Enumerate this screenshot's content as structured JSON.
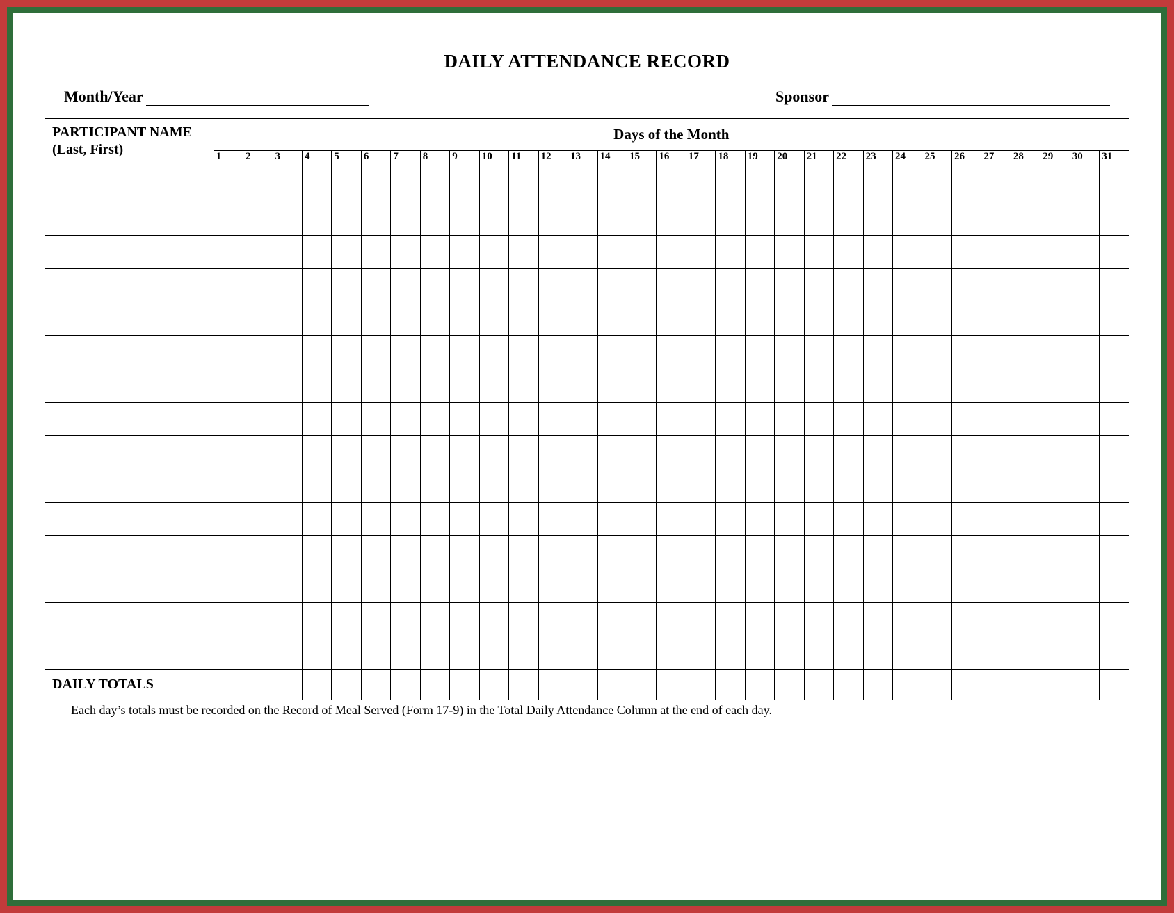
{
  "title": "DAILY ATTENDANCE RECORD",
  "meta": {
    "month_year_label": "Month/Year",
    "month_year_value": "",
    "sponsor_label": "Sponsor",
    "sponsor_value": ""
  },
  "table": {
    "participant_header": "PARTICIPANT NAME (Last, First)",
    "days_header": "Days of the Month",
    "days": [
      "1",
      "2",
      "3",
      "4",
      "5",
      "6",
      "7",
      "8",
      "9",
      "10",
      "11",
      "12",
      "13",
      "14",
      "15",
      "16",
      "17",
      "18",
      "19",
      "20",
      "21",
      "22",
      "23",
      "24",
      "25",
      "26",
      "27",
      "28",
      "29",
      "30",
      "31"
    ],
    "participant_rows": 15,
    "daily_totals_label": "DAILY TOTALS"
  },
  "footnote": "Each day’s totals must be recorded on the Record of Meal Served (Form 17-9) in the Total Daily Attendance Column at the end of each day."
}
